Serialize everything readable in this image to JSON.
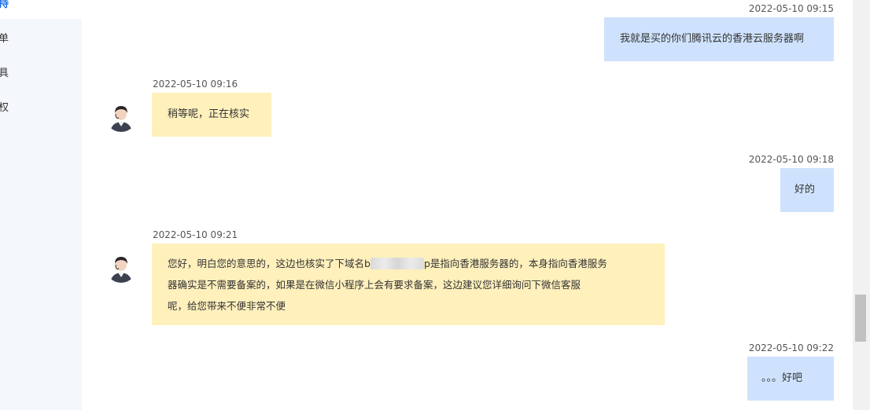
{
  "sidebar": {
    "items": [
      {
        "label": "持",
        "active": true
      },
      {
        "label": "单",
        "active": false
      },
      {
        "label": "具",
        "active": false
      },
      {
        "label": "权",
        "active": false
      }
    ]
  },
  "messages": [
    {
      "role": "user",
      "time": "2022-05-10 09:15",
      "text": "我就是买的你们腾讯云的香港云服务器啊"
    },
    {
      "role": "agent",
      "time": "2022-05-10 09:16",
      "text": "稍等呢，正在核实"
    },
    {
      "role": "user",
      "time": "2022-05-10 09:18",
      "text": "好的"
    },
    {
      "role": "agent",
      "time": "2022-05-10 09:21",
      "lines": {
        "l1_pre": "您好，明白您的意思的，这边也核实了下域名b",
        "l1_post": "p是指向香港服务器的，本身指向香港服务",
        "l2": "器确实是不需要备案的，如果是在微信小程序上会有要求备案，这边建议您详细询问下微信客服",
        "l3": "呢，给您带来不便非常不便"
      }
    },
    {
      "role": "user",
      "time": "2022-05-10 09:22",
      "text": "。。。好吧"
    }
  ],
  "colors": {
    "user_bubble": "#cfe2fd",
    "agent_bubble": "#fff0bc",
    "sidebar_active": "#1f6fe5"
  }
}
